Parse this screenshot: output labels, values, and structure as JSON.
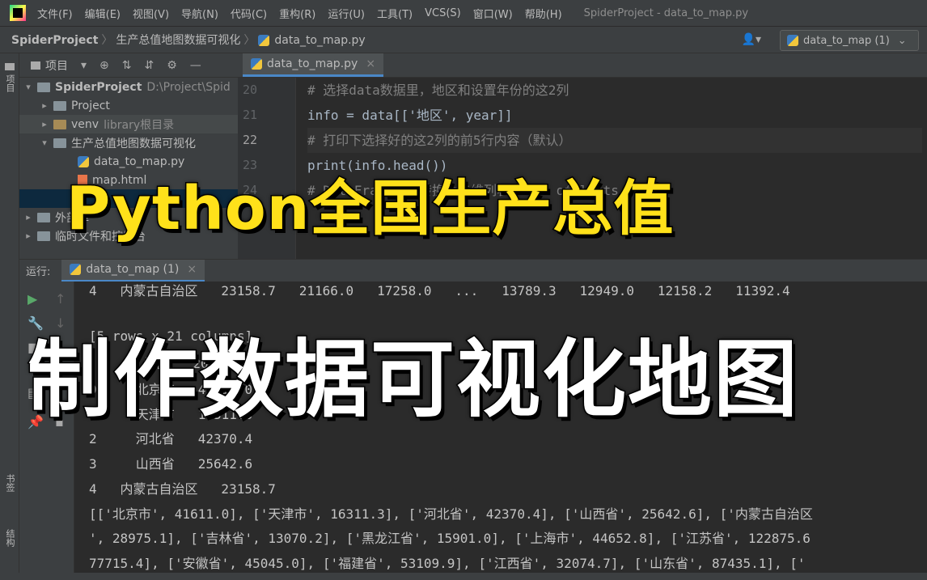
{
  "menubar": {
    "items": [
      "文件(F)",
      "编辑(E)",
      "视图(V)",
      "导航(N)",
      "代码(C)",
      "重构(R)",
      "运行(U)",
      "工具(T)",
      "VCS(S)",
      "窗口(W)",
      "帮助(H)"
    ],
    "window_title": "SpiderProject - data_to_map.py"
  },
  "navbar": {
    "project": "SpiderProject",
    "folder": "生产总值地图数据可视化",
    "file": "data_to_map.py",
    "run_config": "data_to_map (1)"
  },
  "left_strip": {
    "project_tab": "项目",
    "bookmarks_tab": "书签",
    "structure_tab": "结构"
  },
  "project_panel": {
    "title": "项目",
    "root": "SpiderProject",
    "root_path": "D:\\Project\\Spid",
    "items": [
      "Project",
      "venv",
      "生产总值地图数据可视化",
      "data_to_map.py",
      "map.html"
    ],
    "venv_note": "library根目录",
    "external": "外部库",
    "scratches": "临时文件和控制台"
  },
  "editor": {
    "tab": "data_to_map.py",
    "line_numbers": [
      "20",
      "21",
      "22",
      "23",
      "24"
    ],
    "lines": [
      "# 选择data数据里，地区和设置年份的这2列",
      "info = data[['地区', year]]",
      "# 打印下选择好的这2列的前5行内容（默认）",
      "print(info.head())",
      "# DataFrame数据转换为二维列表 list of lists"
    ]
  },
  "run_panel": {
    "label": "运行:",
    "tab": "data_to_map (1)",
    "console": [
      "4   内蒙古自治区   23158.7   21166.0   17258.0   ...   13789.3   12949.0   12158.2   11392.4",
      "[5 rows x 21 columns]",
      "       地区   2020年",
      "0     北京市   41611.0",
      "1     天津市   16311.3",
      "2     河北省   42370.4",
      "3     山西省   25642.6",
      "4   内蒙古自治区   23158.7",
      "[['北京市', 41611.0], ['天津市', 16311.3], ['河北省', 42370.4], ['山西省', 25642.6], ['内蒙古自治区",
      "', 28975.1], ['吉林省', 13070.2], ['黑龙江省', 15901.0], ['上海市', 44652.8], ['江苏省', 122875.6",
      "77715.4], ['安徽省', 45045.0], ['福建省', 53109.9], ['江西省', 32074.7], ['山东省', 87435.1], ['"
    ]
  },
  "overlay": {
    "title_line1": "Python全国生产总值",
    "title_line2": "制作数据可视化地图"
  },
  "colors": {
    "banner1": "#ffe11a",
    "banner2": "#ffffff",
    "accent": "#4a88c7"
  }
}
